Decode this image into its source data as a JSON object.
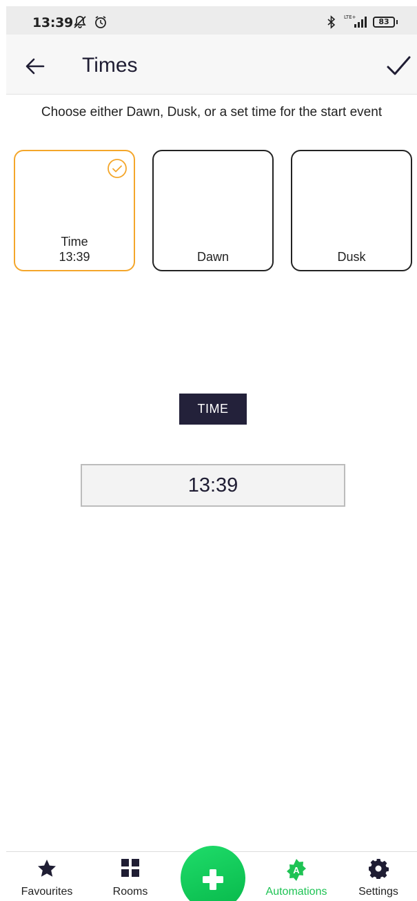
{
  "status_bar": {
    "time": "13:39",
    "network": "LTE+",
    "battery": "83"
  },
  "header": {
    "title": "Times"
  },
  "instruction": "Choose either Dawn, Dusk, or a set time for the start event",
  "options": [
    {
      "label": "Time",
      "value": "13:39",
      "selected": true
    },
    {
      "label": "Dawn",
      "selected": false
    },
    {
      "label": "Dusk",
      "selected": false
    }
  ],
  "time_section": {
    "tag": "TIME",
    "value": "13:39"
  },
  "bottom_nav": {
    "items": [
      {
        "label": "Favourites",
        "icon": "star-icon",
        "active": false
      },
      {
        "label": "Rooms",
        "icon": "grid-icon",
        "active": false
      },
      {
        "label": "Automations",
        "icon": "automations-icon",
        "active": true
      },
      {
        "label": "Settings",
        "icon": "gear-icon",
        "active": false
      }
    ],
    "fab_icon": "plus-icon"
  },
  "colors": {
    "accent_selected": "#f4a62a",
    "active_nav": "#1ec354",
    "fab": "#10cc5a",
    "dark_tag": "#23213a"
  }
}
